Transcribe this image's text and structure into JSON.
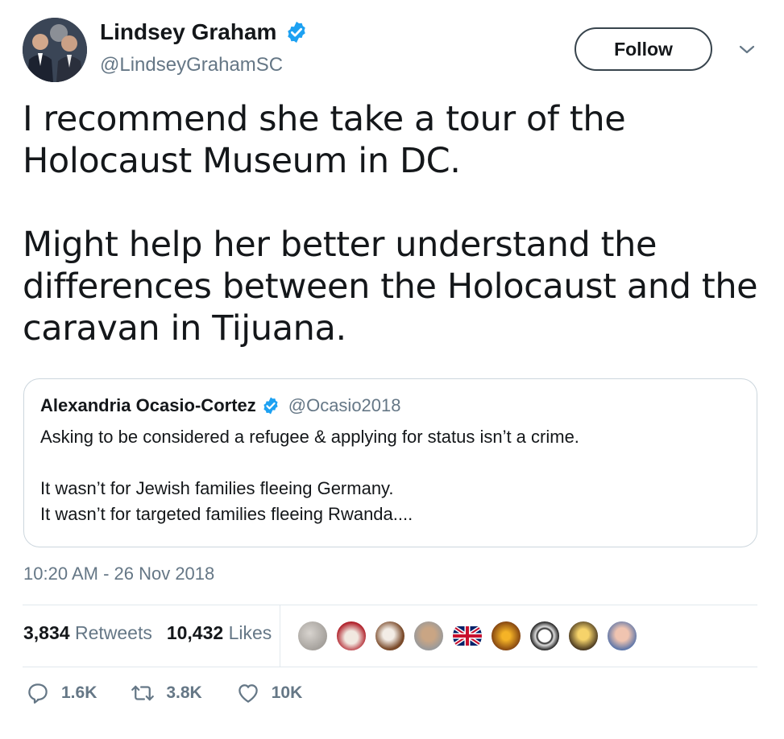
{
  "author": {
    "name": "Lindsey Graham",
    "handle": "@LindseyGrahamSC",
    "verified": true
  },
  "follow_label": "Follow",
  "tweet_text": "I recommend she take a tour of the\nHolocaust Museum in DC.\n\nMight help her better understand the\ndifferences between the Holocaust and the\ncaravan in Tijuana.",
  "quoted_tweet": {
    "name": "Alexandria Ocasio-Cortez",
    "handle": "@Ocasio2018",
    "verified": true,
    "text": "Asking to be considered a refugee & applying for status isn’t a crime.\n\nIt wasn’t for Jewish families fleeing Germany.\nIt wasn’t for targeted families fleeing Rwanda...."
  },
  "timestamp": "10:20 AM - 26 Nov 2018",
  "stats": {
    "retweets_count": "3,834",
    "retweets_label": "Retweets",
    "likes_count": "10,432",
    "likes_label": "Likes"
  },
  "actions": {
    "reply_count": "1.6K",
    "retweet_count": "3.8K",
    "like_count": "10K"
  },
  "colors": {
    "accent": "#1da1f2",
    "secondary_text": "#657786",
    "border": "#e1e8ed"
  }
}
